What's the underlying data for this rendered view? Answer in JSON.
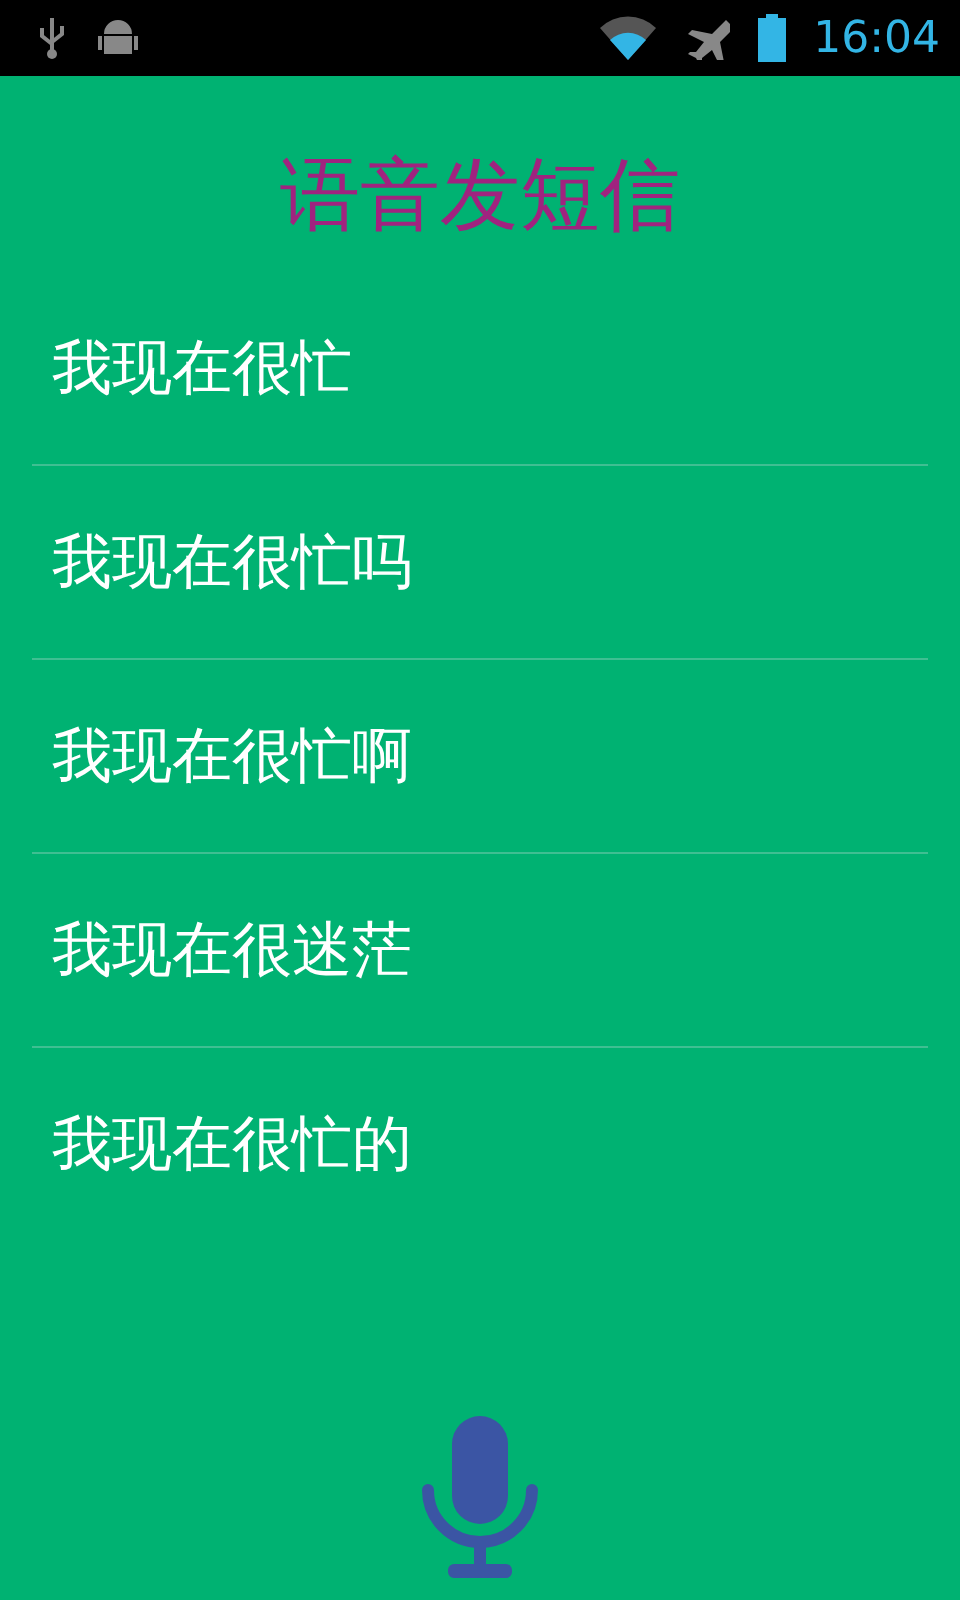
{
  "status_bar": {
    "time": "16:04"
  },
  "title": "语音发短信",
  "messages": [
    "我现在很忙",
    "我现在很忙吗",
    "我现在很忙啊",
    "我现在很迷茫",
    "我现在很忙的"
  ]
}
